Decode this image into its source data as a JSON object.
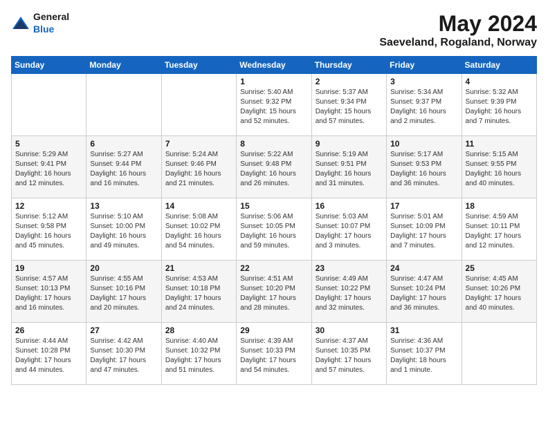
{
  "header": {
    "logo_general": "General",
    "logo_blue": "Blue",
    "title": "May 2024",
    "subtitle": "Saeveland, Rogaland, Norway"
  },
  "days_of_week": [
    "Sunday",
    "Monday",
    "Tuesday",
    "Wednesday",
    "Thursday",
    "Friday",
    "Saturday"
  ],
  "weeks": [
    {
      "cells": [
        {
          "day": "",
          "info": ""
        },
        {
          "day": "",
          "info": ""
        },
        {
          "day": "",
          "info": ""
        },
        {
          "day": "1",
          "info": "Sunrise: 5:40 AM\nSunset: 9:32 PM\nDaylight: 15 hours\nand 52 minutes."
        },
        {
          "day": "2",
          "info": "Sunrise: 5:37 AM\nSunset: 9:34 PM\nDaylight: 15 hours\nand 57 minutes."
        },
        {
          "day": "3",
          "info": "Sunrise: 5:34 AM\nSunset: 9:37 PM\nDaylight: 16 hours\nand 2 minutes."
        },
        {
          "day": "4",
          "info": "Sunrise: 5:32 AM\nSunset: 9:39 PM\nDaylight: 16 hours\nand 7 minutes."
        }
      ]
    },
    {
      "cells": [
        {
          "day": "5",
          "info": "Sunrise: 5:29 AM\nSunset: 9:41 PM\nDaylight: 16 hours\nand 12 minutes."
        },
        {
          "day": "6",
          "info": "Sunrise: 5:27 AM\nSunset: 9:44 PM\nDaylight: 16 hours\nand 16 minutes."
        },
        {
          "day": "7",
          "info": "Sunrise: 5:24 AM\nSunset: 9:46 PM\nDaylight: 16 hours\nand 21 minutes."
        },
        {
          "day": "8",
          "info": "Sunrise: 5:22 AM\nSunset: 9:48 PM\nDaylight: 16 hours\nand 26 minutes."
        },
        {
          "day": "9",
          "info": "Sunrise: 5:19 AM\nSunset: 9:51 PM\nDaylight: 16 hours\nand 31 minutes."
        },
        {
          "day": "10",
          "info": "Sunrise: 5:17 AM\nSunset: 9:53 PM\nDaylight: 16 hours\nand 36 minutes."
        },
        {
          "day": "11",
          "info": "Sunrise: 5:15 AM\nSunset: 9:55 PM\nDaylight: 16 hours\nand 40 minutes."
        }
      ]
    },
    {
      "cells": [
        {
          "day": "12",
          "info": "Sunrise: 5:12 AM\nSunset: 9:58 PM\nDaylight: 16 hours\nand 45 minutes."
        },
        {
          "day": "13",
          "info": "Sunrise: 5:10 AM\nSunset: 10:00 PM\nDaylight: 16 hours\nand 49 minutes."
        },
        {
          "day": "14",
          "info": "Sunrise: 5:08 AM\nSunset: 10:02 PM\nDaylight: 16 hours\nand 54 minutes."
        },
        {
          "day": "15",
          "info": "Sunrise: 5:06 AM\nSunset: 10:05 PM\nDaylight: 16 hours\nand 59 minutes."
        },
        {
          "day": "16",
          "info": "Sunrise: 5:03 AM\nSunset: 10:07 PM\nDaylight: 17 hours\nand 3 minutes."
        },
        {
          "day": "17",
          "info": "Sunrise: 5:01 AM\nSunset: 10:09 PM\nDaylight: 17 hours\nand 7 minutes."
        },
        {
          "day": "18",
          "info": "Sunrise: 4:59 AM\nSunset: 10:11 PM\nDaylight: 17 hours\nand 12 minutes."
        }
      ]
    },
    {
      "cells": [
        {
          "day": "19",
          "info": "Sunrise: 4:57 AM\nSunset: 10:13 PM\nDaylight: 17 hours\nand 16 minutes."
        },
        {
          "day": "20",
          "info": "Sunrise: 4:55 AM\nSunset: 10:16 PM\nDaylight: 17 hours\nand 20 minutes."
        },
        {
          "day": "21",
          "info": "Sunrise: 4:53 AM\nSunset: 10:18 PM\nDaylight: 17 hours\nand 24 minutes."
        },
        {
          "day": "22",
          "info": "Sunrise: 4:51 AM\nSunset: 10:20 PM\nDaylight: 17 hours\nand 28 minutes."
        },
        {
          "day": "23",
          "info": "Sunrise: 4:49 AM\nSunset: 10:22 PM\nDaylight: 17 hours\nand 32 minutes."
        },
        {
          "day": "24",
          "info": "Sunrise: 4:47 AM\nSunset: 10:24 PM\nDaylight: 17 hours\nand 36 minutes."
        },
        {
          "day": "25",
          "info": "Sunrise: 4:45 AM\nSunset: 10:26 PM\nDaylight: 17 hours\nand 40 minutes."
        }
      ]
    },
    {
      "cells": [
        {
          "day": "26",
          "info": "Sunrise: 4:44 AM\nSunset: 10:28 PM\nDaylight: 17 hours\nand 44 minutes."
        },
        {
          "day": "27",
          "info": "Sunrise: 4:42 AM\nSunset: 10:30 PM\nDaylight: 17 hours\nand 47 minutes."
        },
        {
          "day": "28",
          "info": "Sunrise: 4:40 AM\nSunset: 10:32 PM\nDaylight: 17 hours\nand 51 minutes."
        },
        {
          "day": "29",
          "info": "Sunrise: 4:39 AM\nSunset: 10:33 PM\nDaylight: 17 hours\nand 54 minutes."
        },
        {
          "day": "30",
          "info": "Sunrise: 4:37 AM\nSunset: 10:35 PM\nDaylight: 17 hours\nand 57 minutes."
        },
        {
          "day": "31",
          "info": "Sunrise: 4:36 AM\nSunset: 10:37 PM\nDaylight: 18 hours\nand 1 minute."
        },
        {
          "day": "",
          "info": ""
        }
      ]
    }
  ]
}
